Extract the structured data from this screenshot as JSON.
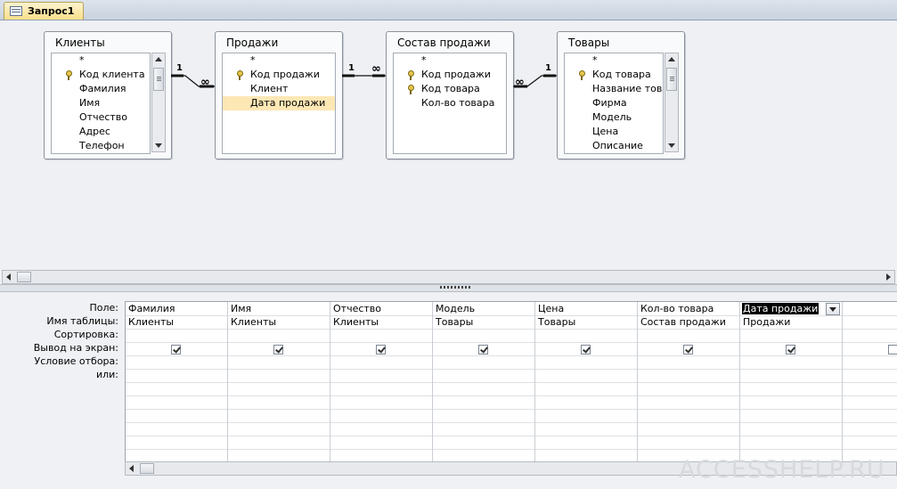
{
  "tab": {
    "title": "Запрос1",
    "icon": "query-icon"
  },
  "tables": [
    {
      "title": "Клиенты",
      "fields": [
        "*",
        "Код клиента",
        "Фамилия",
        "Имя",
        "Отчество",
        "Адрес",
        "Телефон"
      ],
      "keys": [
        1
      ]
    },
    {
      "title": "Продажи",
      "fields": [
        "*",
        "Код продажи",
        "Клиент",
        "Дата продажи"
      ],
      "keys": [
        1
      ],
      "selected": 3
    },
    {
      "title": "Состав продажи",
      "fields": [
        "*",
        "Код продажи",
        "Код товара",
        "Кол-во товара"
      ],
      "keys": [
        1,
        2
      ]
    },
    {
      "title": "Товары",
      "fields": [
        "*",
        "Код товара",
        "Название товар",
        "Фирма",
        "Модель",
        "Цена",
        "Описание"
      ],
      "keys": [
        1
      ]
    }
  ],
  "relations": {
    "one": "1",
    "many": "∞"
  },
  "row_labels": [
    "Поле:",
    "Имя таблицы:",
    "Сортировка:",
    "Вывод на экран:",
    "Условие отбора:",
    "или:"
  ],
  "columns": [
    {
      "field": "Фамилия",
      "table": "Клиенты",
      "show": true
    },
    {
      "field": "Имя",
      "table": "Клиенты",
      "show": true
    },
    {
      "field": "Отчество",
      "table": "Клиенты",
      "show": true
    },
    {
      "field": "Модель",
      "table": "Товары",
      "show": true
    },
    {
      "field": "Цена",
      "table": "Товары",
      "show": true
    },
    {
      "field": "Кол-во товара",
      "table": "Состав продажи",
      "show": true
    },
    {
      "field": "Дата продажи",
      "table": "Продажи",
      "show": true
    },
    {
      "field": "",
      "table": "",
      "show": false
    }
  ],
  "watermark": "ACCESSHELP.RU"
}
